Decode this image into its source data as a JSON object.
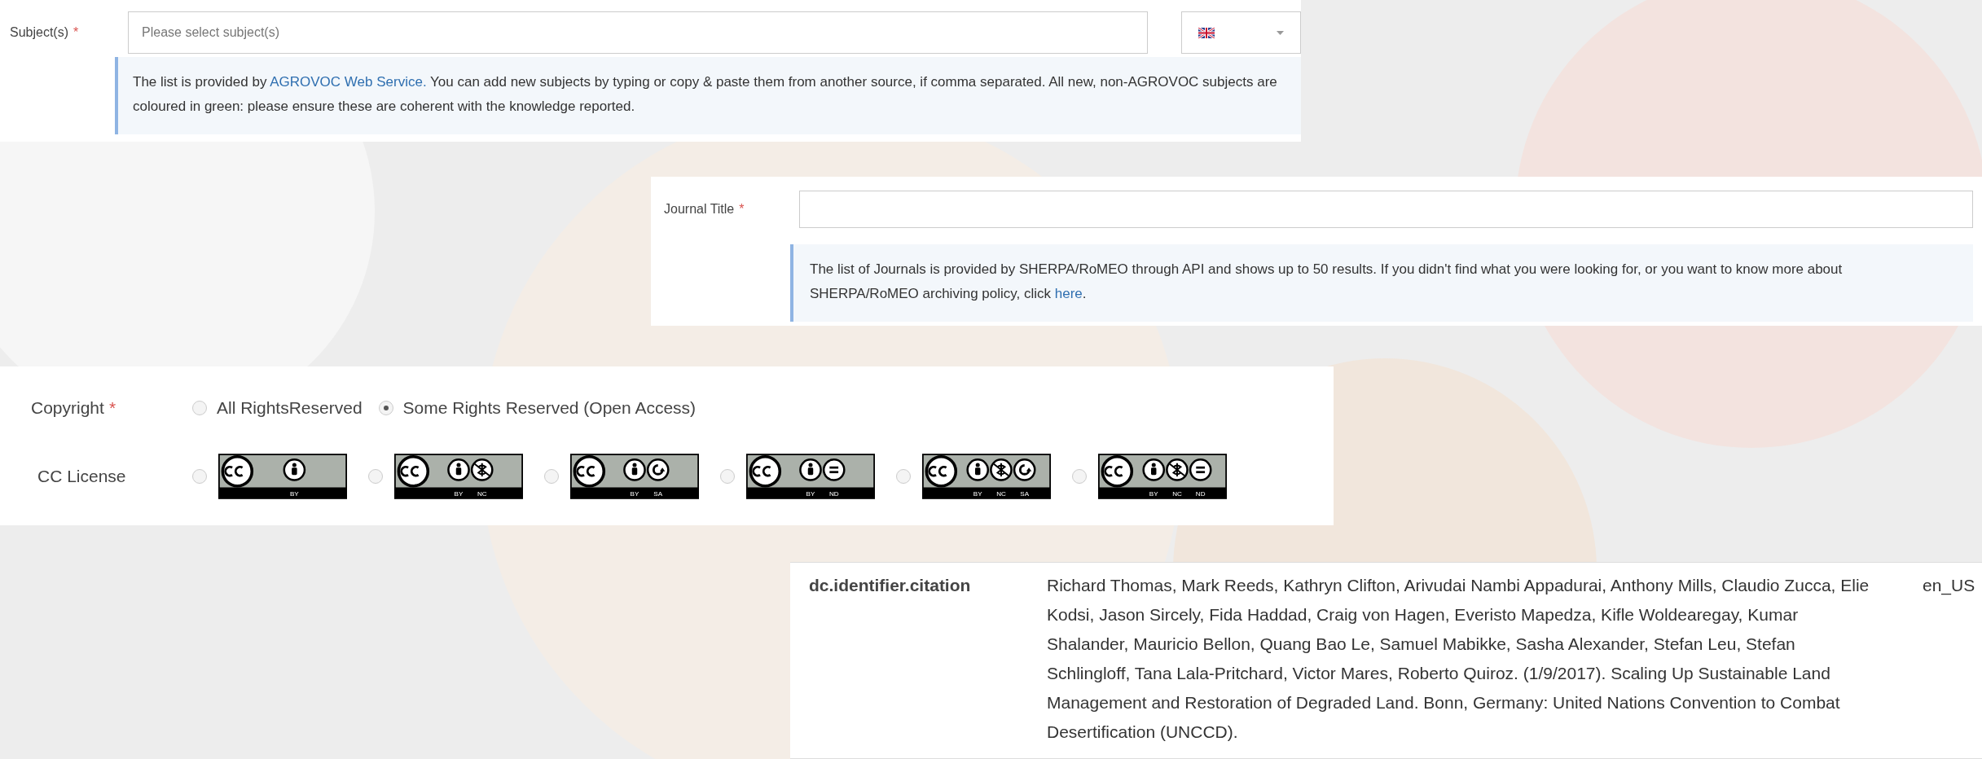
{
  "subjects_panel": {
    "label": "Subject(s)",
    "required_mark": "*",
    "placeholder": "Please select subject(s)",
    "info_before": "The list is provided by ",
    "info_link": "AGROVOC Web Service.",
    "info_after": " You can add new subjects by typing or copy & paste them from another source, if comma separated. All new, non-AGROVOC subjects are coloured in green: please ensure these are coherent with the knowledge reported."
  },
  "journal_panel": {
    "label": "Journal Title",
    "required_mark": "*",
    "info_before": "The list of Journals is provided by SHERPA/RoMEO through API and shows up to 50 results. If you didn't find what you were looking for, or you want to know more about SHERPA/RoMEO archiving policy, click ",
    "info_link": "here",
    "info_after": "."
  },
  "copyright_panel": {
    "label": "Copyright",
    "required_mark": "*",
    "options": [
      {
        "label": "All RightsReserved",
        "selected": false
      },
      {
        "label": "Some Rights Reserved (Open Access)",
        "selected": true
      }
    ],
    "cc_label": "CC License",
    "licenses": [
      {
        "terms": [
          "BY"
        ],
        "selected": false
      },
      {
        "terms": [
          "BY",
          "NC"
        ],
        "selected": false
      },
      {
        "terms": [
          "BY",
          "SA"
        ],
        "selected": false
      },
      {
        "terms": [
          "BY",
          "ND"
        ],
        "selected": false
      },
      {
        "terms": [
          "BY",
          "NC",
          "SA"
        ],
        "selected": false
      },
      {
        "terms": [
          "BY",
          "NC",
          "ND"
        ],
        "selected": false
      }
    ]
  },
  "metadata_row": {
    "key": "dc.identifier.citation",
    "value": "Richard Thomas, Mark Reeds, Kathryn Clifton, Arivudai Nambi Appadurai, Anthony Mills, Claudio Zucca, Elie Kodsi, Jason Sircely, Fida Haddad, Craig von Hagen, Everisto Mapedza, Kifle Woldearegay, Kumar Shalander, Mauricio Bellon, Quang Bao Le, Samuel Mabikke, Sasha Alexander, Stefan Leu, Stefan Schlingloff, Tana Lala-Pritchard, Victor Mares, Roberto Quiroz. (1/9/2017). Scaling Up Sustainable Land Management and Restoration of Degraded Land. Bonn, Germany: United Nations Convention to Combat Desertification (UNCCD).",
    "language": "en_US"
  }
}
